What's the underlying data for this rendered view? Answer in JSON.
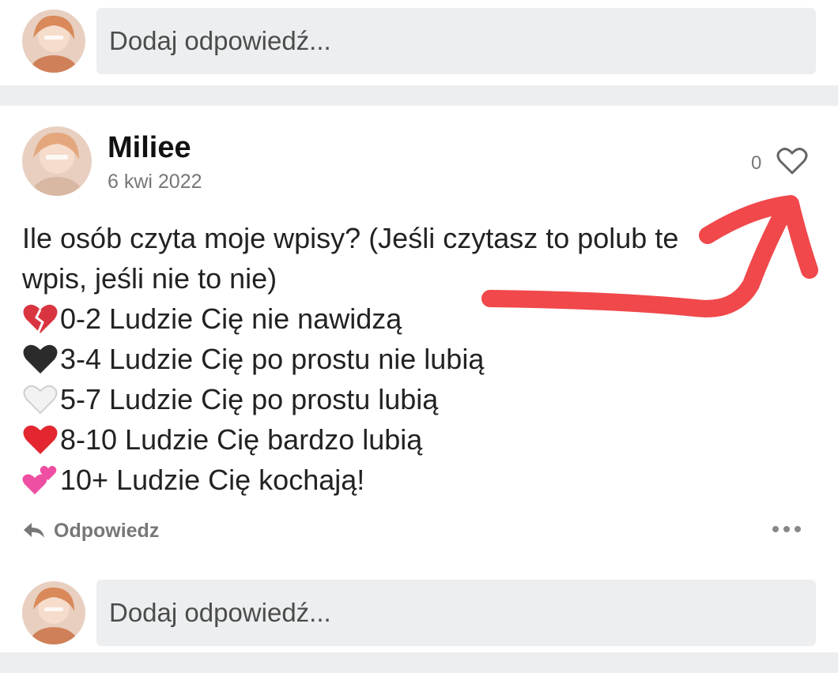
{
  "reply_top": {
    "placeholder": "Dodaj odpowiedź..."
  },
  "post": {
    "author": "Miliee",
    "date": "6 kwi 2022",
    "likes": "0",
    "body": {
      "line1": "Ile osób czyta moje wpisy? (Jeśli czytasz to polub te",
      "line2": "wpis, jeśli nie to nie)",
      "items": [
        {
          "icon": "broken-heart-icon",
          "text": "0-2 Ludzie Cię nie nawidzą"
        },
        {
          "icon": "black-heart-icon",
          "text": "3-4 Ludzie Cię po prostu nie lubią"
        },
        {
          "icon": "white-heart-icon",
          "text": "5-7 Ludzie Cię po prostu lubią"
        },
        {
          "icon": "red-heart-icon",
          "text": "8-10 Ludzie Cię bardzo lubią"
        },
        {
          "icon": "two-hearts-icon",
          "text": "10+ Ludzie Cię kochają!"
        }
      ]
    },
    "reply_label": "Odpowiedz"
  },
  "reply_bottom": {
    "placeholder": "Dodaj odpowiedź..."
  },
  "colors": {
    "annotation_arrow": "#f0484b",
    "divider": "#eceeef"
  }
}
